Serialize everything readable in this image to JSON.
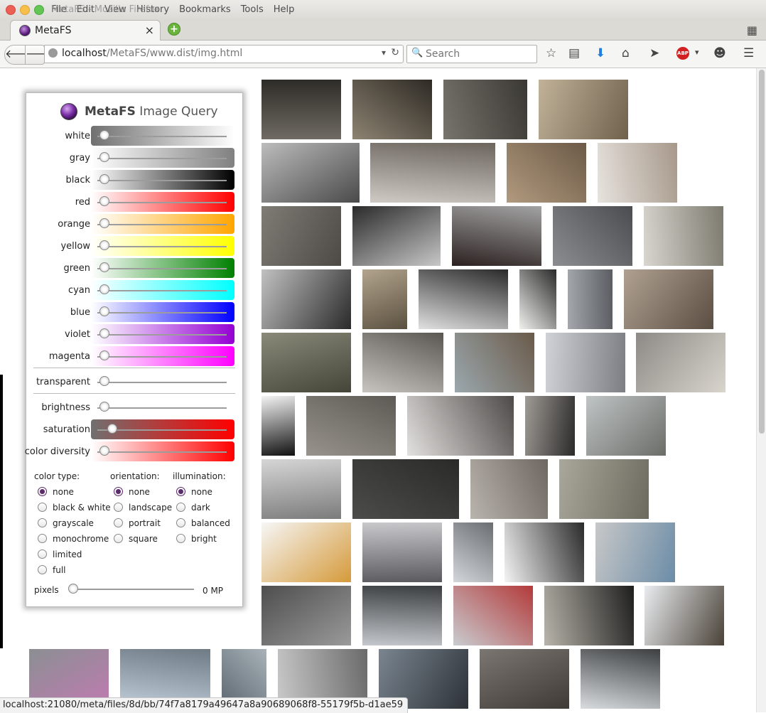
{
  "window": {
    "menu": [
      "File",
      "Edit",
      "View",
      "History",
      "Bookmarks",
      "Tools",
      "Help"
    ],
    "title_overlay": "MetaFS - Mozilla Firefox"
  },
  "tab": {
    "title": "MetaFS",
    "close": "×"
  },
  "navbar": {
    "url_host": "localhost",
    "url_path": "/MetaFS/www.dist/img.html",
    "search_placeholder": "Search",
    "abp_label": "ABP"
  },
  "panel": {
    "brand": "MetaFS",
    "title": " Image Query",
    "color_sliders": [
      {
        "label": "white",
        "colors": [
          "#707070",
          "#ffffff"
        ],
        "value": 0
      },
      {
        "label": "gray",
        "colors": [
          "#ffffff",
          "#808080"
        ],
        "value": 0
      },
      {
        "label": "black",
        "colors": [
          "#ffffff",
          "#000000"
        ],
        "value": 0
      },
      {
        "label": "red",
        "colors": [
          "#ffffff",
          "#ff0000"
        ],
        "value": 0
      },
      {
        "label": "orange",
        "colors": [
          "#ffffff",
          "#ffa500"
        ],
        "value": 0
      },
      {
        "label": "yellow",
        "colors": [
          "#ffffff",
          "#ffff00"
        ],
        "value": 0
      },
      {
        "label": "green",
        "colors": [
          "#ffffff",
          "#008000"
        ],
        "value": 0
      },
      {
        "label": "cyan",
        "colors": [
          "#ffffff",
          "#00ffff"
        ],
        "value": 0
      },
      {
        "label": "blue",
        "colors": [
          "#ffffff",
          "#0000ff"
        ],
        "value": 0
      },
      {
        "label": "violet",
        "colors": [
          "#ffffff",
          "#9400d3"
        ],
        "value": 0
      },
      {
        "label": "magenta",
        "colors": [
          "#ffffff",
          "#ff00ff"
        ],
        "value": 0
      }
    ],
    "transparent": {
      "label": "transparent",
      "value": 0
    },
    "tone_sliders": [
      {
        "label": "brightness",
        "colors": null,
        "value": 0
      },
      {
        "label": "saturation",
        "colors": [
          "#707070",
          "#ff0000"
        ],
        "value": 0.06
      },
      {
        "label": "color diversity",
        "colors": [
          "#ffffff",
          "#ff0000"
        ],
        "value": 0
      }
    ],
    "color_type": {
      "heading": "color type:",
      "options": [
        "none",
        "black & white",
        "grayscale",
        "monochrome",
        "limited",
        "full"
      ],
      "selected": "none"
    },
    "orientation": {
      "heading": "orientation:",
      "options": [
        "none",
        "landscape",
        "portrait",
        "square"
      ],
      "selected": "none"
    },
    "illumination": {
      "heading": "illumination:",
      "options": [
        "none",
        "dark",
        "balanced",
        "bright"
      ],
      "selected": "none"
    },
    "pixels": {
      "label": "pixels",
      "value_text": "0 MP",
      "value": 0
    }
  },
  "status": "localhost:21080/meta/files/8d/bb/74f7a8179a49647a8a90689068f8-55179f5b-d1ae59"
}
